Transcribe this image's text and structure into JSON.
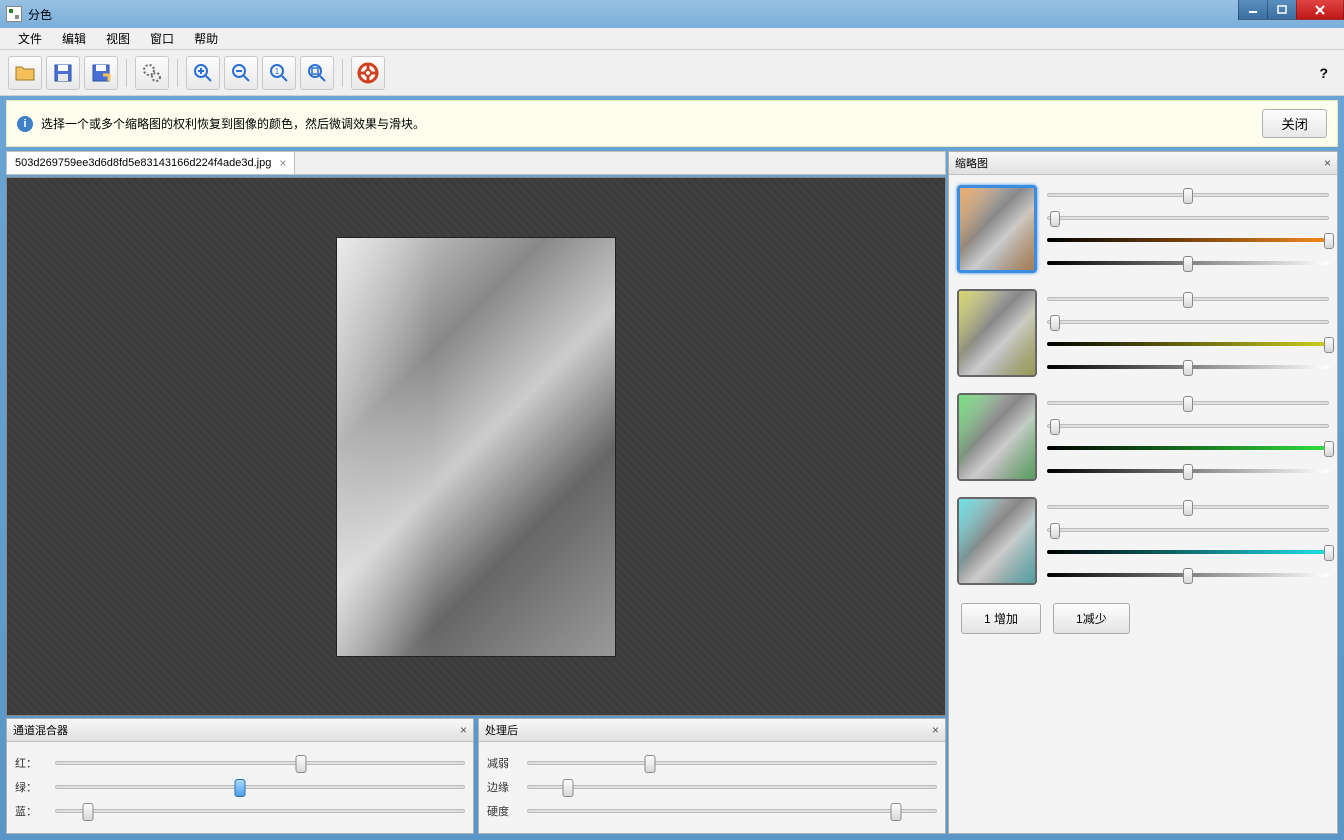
{
  "window": {
    "title": "分色"
  },
  "menu": [
    "文件",
    "编辑",
    "视图",
    "窗口",
    "帮助"
  ],
  "toolbar": {
    "icons": [
      "open",
      "save",
      "save-as",
      "settings",
      "zoom-in",
      "zoom-out",
      "zoom-actual",
      "zoom-fit",
      "help-ring"
    ],
    "help_mark": "?"
  },
  "info": {
    "text": "选择一个或多个缩略图的权利恢复到图像的颜色，然后微调效果与滑块。",
    "close": "关闭"
  },
  "tab": {
    "filename": "503d269759ee3d6d8fd5e83143166d224f4ade3d.jpg",
    "close": "×"
  },
  "panels": {
    "mixer": {
      "title": "通道混合器",
      "rows": [
        {
          "label": "红：",
          "value": 60
        },
        {
          "label": "绿：",
          "value": 45,
          "active": true
        },
        {
          "label": "蓝：",
          "value": 8
        }
      ]
    },
    "post": {
      "title": "处理后",
      "rows": [
        {
          "label": "减弱",
          "value": 30
        },
        {
          "label": "边缘",
          "value": 10
        },
        {
          "label": "硬度",
          "value": 90
        }
      ]
    },
    "thumbs": {
      "title": "缩略图",
      "items": [
        {
          "tint": "#f28a1e",
          "grad": [
            "#000",
            "#f28a1e"
          ],
          "selected": true,
          "s1": 50,
          "s2": 3,
          "s3": 50
        },
        {
          "tint": "#cfcf20",
          "grad": [
            "#000",
            "#cfcf20"
          ],
          "selected": false,
          "s1": 50,
          "s2": 3,
          "s3": 50
        },
        {
          "tint": "#30e040",
          "grad": [
            "#000",
            "#30e040"
          ],
          "selected": false,
          "s1": 50,
          "s2": 3,
          "s3": 50
        },
        {
          "tint": "#20e0e8",
          "grad": [
            "#000",
            "#20e0e8"
          ],
          "selected": false,
          "s1": 50,
          "s2": 3,
          "s3": 50
        }
      ],
      "add": "1 增加",
      "remove": "1减少"
    }
  }
}
